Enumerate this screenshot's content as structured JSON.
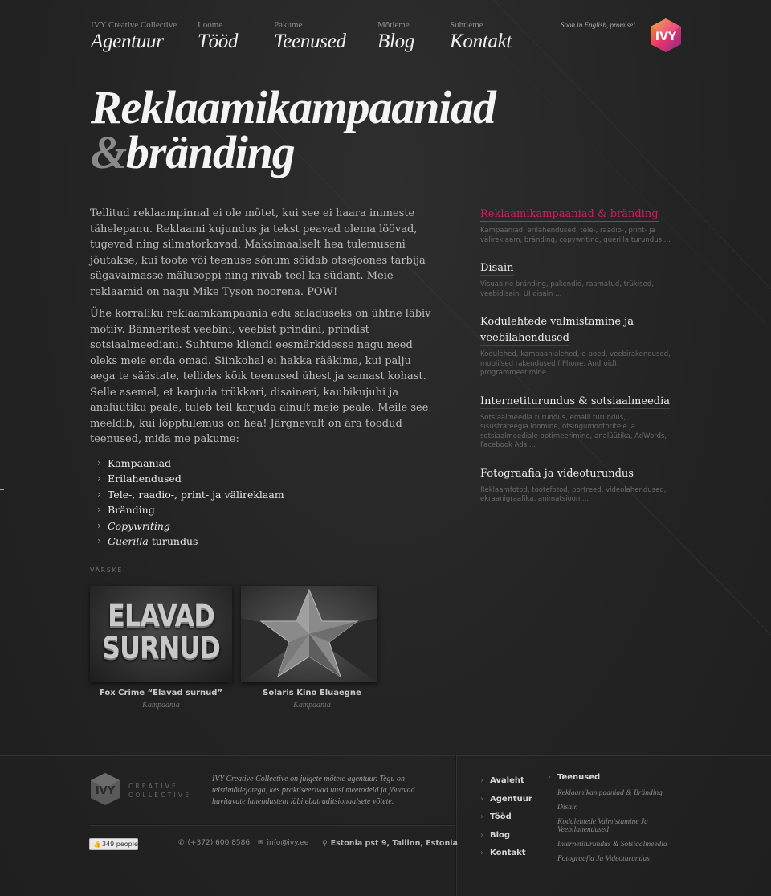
{
  "header": {
    "nav": [
      {
        "small": "IVY Creative Collective",
        "big": "Agentuur"
      },
      {
        "small": "Loome",
        "big": "Tööd"
      },
      {
        "small": "Pakume",
        "big": "Teenused"
      },
      {
        "small": "Mõtleme",
        "big": "Blog"
      },
      {
        "small": "Suhtleme",
        "big": "Kontakt"
      }
    ],
    "soon": "Soon in English, promise!",
    "logo_text": "IVY"
  },
  "hero": {
    "line1": "Reklaamikampaaniad",
    "amp": "&",
    "line2": "bränding"
  },
  "intro": {
    "p1": "Tellitud reklaampinnal ei ole mõtet, kui see ei haara inimeste tähelepanu. Reklaami kujundus ja tekst peavad olema löövad, tugevad ning silmatorkavad. Maksimaalselt hea tulemuseni jõutakse, kui toote või teenuse sõnum sõidab otsejoones tarbija sügavaimasse mälusoppi ning riivab teel ka südant. Meie reklaamid on nagu Mike Tyson noorena. POW!",
    "p2": "Ühe korraliku reklaamkampaania edu saladuseks on ühtne läbiv motiiv. Bänneritest veebini, veebist prindini, prindist sotsiaalmeediani. Suhtume kliendi eesmärkidesse nagu need oleks meie enda omad. Siinkohal ei hakka rääkima, kui palju aega te säästate, tellides kõik teenused ühest ja samast kohast. Selle asemel, et karjuda trükkari, disaineri, kaubikujuhi ja analüütiku peale, tuleb teil karjuda ainult meie peale. Meile see meeldib, kui lõpptulemus on hea! Järgnevalt on ära toodud teenused, mida me pakume:",
    "services": [
      {
        "text": "Kampaaniad"
      },
      {
        "text": "Erilahendused"
      },
      {
        "text": "Tele-, raadio-, print- ja välireklaam"
      },
      {
        "text": "Bränding"
      },
      {
        "text": "Copywriting"
      },
      {
        "em": "Guerilla",
        "text": " turundus"
      }
    ]
  },
  "sidebar": [
    {
      "title": "Reklaamikampaaniad & bränding",
      "desc": "Kampaaniad, erilahendused, tele-, raadio-, print- ja välireklaam, bränding, copywriting, guerilla turundus ...",
      "active": true
    },
    {
      "title": "Disain",
      "desc": "Visuaalne bränding, pakendid, raamatud, trükised, veebidisain, UI disain ...",
      "active": false
    },
    {
      "title": "Kodulehtede valmistamine ja veebilahendused",
      "desc": "Kodulehed, kampaanialehed, e-poed, veebirakendused, mobiilsed rakendused (iPhone, Android), programmeerimine ...",
      "active": false
    },
    {
      "title": "Internetiturundus & sotsiaalmeedia",
      "desc": "Sotsiaalmeedia turundus, emaili turundus, sisustrateegia loomine, otsingumootoritele ja sotsiaalmeediale optimeerimine, analüütika, AdWords, Facebook Ads ...",
      "active": false
    },
    {
      "title": "Fotograafia ja videoturundus",
      "desc": "Reklaamfotod, tootefotod, portreed, videolahendused, ekraanigraafika, animatsioon ...",
      "active": false
    }
  ],
  "fresh": {
    "label": "VÄRSKE",
    "items": [
      {
        "image_text_1": "ELAVAD",
        "image_text_2": "SURNUD",
        "name": "Fox Crime “Elavad surnud”",
        "category": "Kampaania"
      },
      {
        "name": "Solaris Kino Eluaegne",
        "category": "Kampaania"
      }
    ]
  },
  "footer": {
    "logo_text": "IVY",
    "logo_sub1": "CREATIVE",
    "logo_sub2": "COLLECTIVE",
    "about": "IVY Creative Collective on julgete mõtete agentuur. Tegu on teistimõtlejatega, kes praktiseerivad uusi meetodeid ja jõuavad huvitavate lahendusteni läbi ebatraditsionaalsete võtete.",
    "likes": "349 people",
    "phone": "(+372) 600 8586",
    "email": "info@ivy.ee",
    "address": "Estonia pst 9, Tallinn, Estonia",
    "nav": [
      "Avaleht",
      "Agentuur",
      "Tööd",
      "Blog",
      "Kontakt"
    ],
    "services_title": "Teenused",
    "services": [
      "Reklaamikampaaniad & Bränding",
      "Disain",
      "Kodulehtede Valmistamine Ja Veebilahendused",
      "Internetiturundus & Sotsiaalmeedia",
      "Fotograafia Ja Videoturundus"
    ]
  },
  "colors": {
    "accent": "#d51a62",
    "background": "#252525"
  }
}
